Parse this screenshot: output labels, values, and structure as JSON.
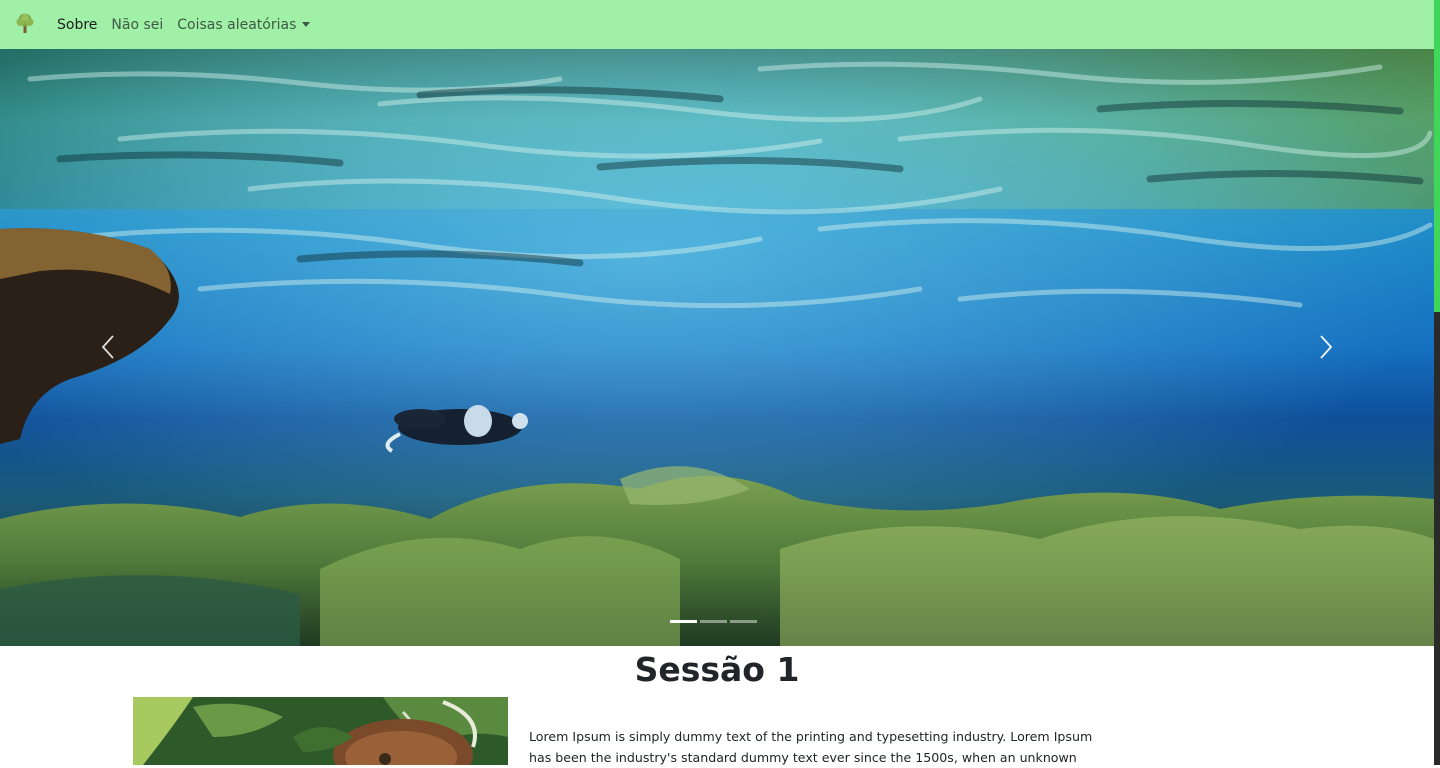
{
  "navbar": {
    "brand_icon": "tree-icon",
    "links": [
      {
        "label": "Sobre",
        "active": true
      },
      {
        "label": "Não sei",
        "active": false
      },
      {
        "label": "Coisas aleatórias",
        "active": false,
        "dropdown": true
      }
    ]
  },
  "carousel": {
    "prev_icon": "chevron-left-icon",
    "next_icon": "chevron-right-icon",
    "indicator_count": 3,
    "active_indicator": 0
  },
  "section": {
    "title": "Sessão 1",
    "text": "Lorem Ipsum is simply dummy text of the printing and typesetting industry. Lorem Ipsum has been the industry's standard dummy text ever since the 1500s, when an unknown"
  },
  "colors": {
    "navbar_bg": "#a0f0a8",
    "scrollbar_thumb": "#3fd65a"
  }
}
